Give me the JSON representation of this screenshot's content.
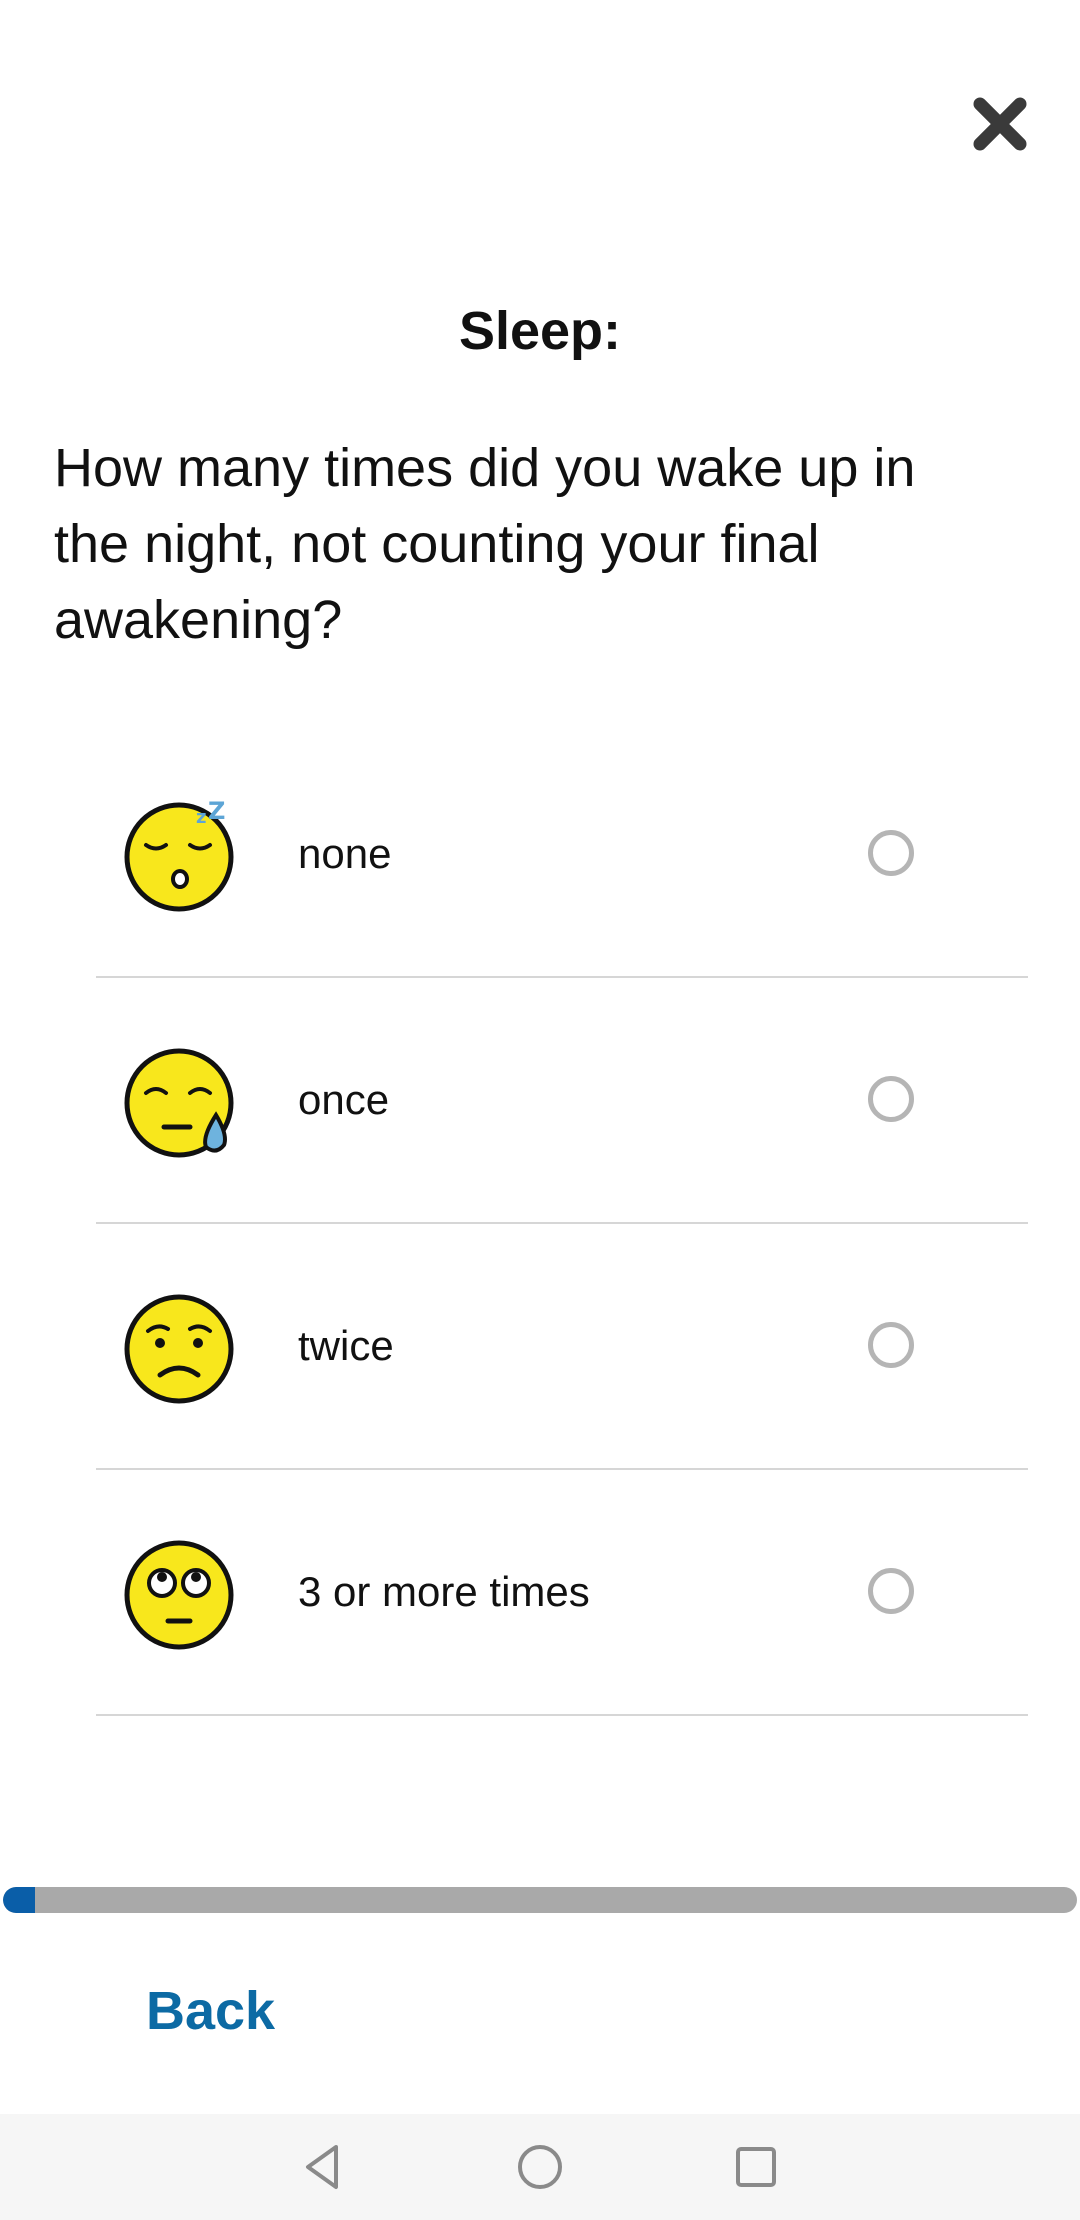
{
  "header": {
    "close_icon": "close-icon"
  },
  "question": {
    "title": "Sleep:",
    "text": "How many times did you wake up in the night, not counting your final awakening?"
  },
  "options": [
    {
      "label": "none",
      "icon": "sleeping-face-icon",
      "selected": false
    },
    {
      "label": "once",
      "icon": "sleepy-face-icon",
      "selected": false
    },
    {
      "label": "twice",
      "icon": "confused-face-icon",
      "selected": false
    },
    {
      "label": "3 or more times",
      "icon": "eye-roll-face-icon",
      "selected": false
    }
  ],
  "progress": {
    "fraction": 0.03
  },
  "footer": {
    "back_label": "Back"
  },
  "colors": {
    "accent": "#0a5ea8",
    "back_text": "#0c6aa4",
    "progress_track": "#a9a9a9",
    "emoji_yellow": "#f8e71c",
    "radio_border": "#b5b5b5"
  },
  "system_nav": {
    "back": "back-triangle-icon",
    "home": "home-circle-icon",
    "recents": "recents-square-icon"
  }
}
